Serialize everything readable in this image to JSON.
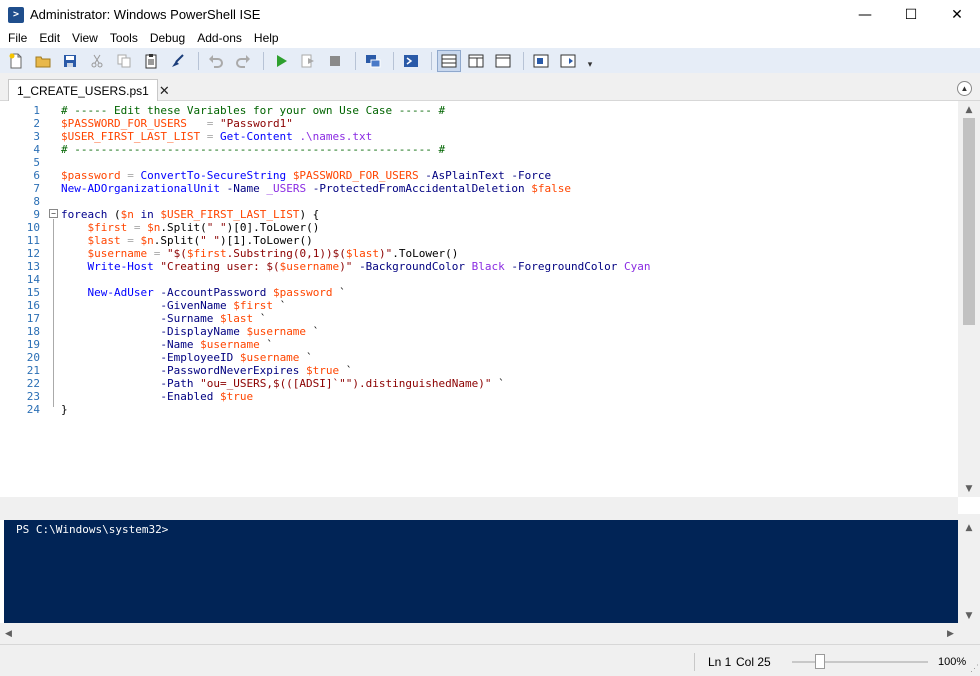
{
  "window": {
    "title": "Administrator: Windows PowerShell ISE",
    "minimize": "—",
    "maximize": "☐",
    "close": "✕"
  },
  "menu": [
    "File",
    "Edit",
    "View",
    "Tools",
    "Debug",
    "Add-ons",
    "Help"
  ],
  "toolbar": {
    "icons": [
      "new-script",
      "open",
      "save",
      "cut",
      "copy",
      "paste",
      "clear-console",
      "undo",
      "redo",
      "run-script",
      "run-selection",
      "stop",
      "new-remote-tab",
      "start-powershell",
      "show-script-top",
      "show-script-right",
      "show-script-max",
      "show-command-window",
      "show-command-addon"
    ]
  },
  "tab": {
    "label": "1_CREATE_USERS.ps1",
    "close": "✕"
  },
  "editor": {
    "lines": [
      [
        [
          "comment",
          "# ----- Edit these Variables for your own Use Case ----- #"
        ]
      ],
      [
        [
          "var",
          "$PASSWORD_FOR_USERS"
        ],
        [
          "plain",
          "   "
        ],
        [
          "op",
          "="
        ],
        [
          "plain",
          " "
        ],
        [
          "str",
          "\"Password1\""
        ]
      ],
      [
        [
          "var",
          "$USER_FIRST_LAST_LIST"
        ],
        [
          "plain",
          " "
        ],
        [
          "op",
          "="
        ],
        [
          "plain",
          " "
        ],
        [
          "cmd",
          "Get-Content"
        ],
        [
          "plain",
          " "
        ],
        [
          "arg",
          ".\\names.txt"
        ]
      ],
      [
        [
          "comment",
          "# ------------------------------------------------------ #"
        ]
      ],
      [],
      [
        [
          "var",
          "$password"
        ],
        [
          "plain",
          " "
        ],
        [
          "op",
          "="
        ],
        [
          "plain",
          " "
        ],
        [
          "cmd",
          "ConvertTo-SecureString"
        ],
        [
          "plain",
          " "
        ],
        [
          "var",
          "$PASSWORD_FOR_USERS"
        ],
        [
          "plain",
          " "
        ],
        [
          "param",
          "-AsPlainText"
        ],
        [
          "plain",
          " "
        ],
        [
          "param",
          "-Force"
        ]
      ],
      [
        [
          "cmd",
          "New-ADOrganizationalUnit"
        ],
        [
          "plain",
          " "
        ],
        [
          "param",
          "-Name"
        ],
        [
          "plain",
          " "
        ],
        [
          "arg",
          "_USERS"
        ],
        [
          "plain",
          " "
        ],
        [
          "param",
          "-ProtectedFromAccidentalDeletion"
        ],
        [
          "plain",
          " "
        ],
        [
          "var",
          "$false"
        ]
      ],
      [],
      [
        [
          "kw",
          "foreach"
        ],
        [
          "plain",
          " ("
        ],
        [
          "var",
          "$n"
        ],
        [
          "plain",
          " "
        ],
        [
          "kw",
          "in"
        ],
        [
          "plain",
          " "
        ],
        [
          "var",
          "$USER_FIRST_LAST_LIST"
        ],
        [
          "plain",
          ") {"
        ]
      ],
      [
        [
          "plain",
          "    "
        ],
        [
          "var",
          "$first"
        ],
        [
          "plain",
          " "
        ],
        [
          "op",
          "="
        ],
        [
          "plain",
          " "
        ],
        [
          "var",
          "$n"
        ],
        [
          "plain",
          ".Split("
        ],
        [
          "str",
          "\" \""
        ],
        [
          "plain",
          ")[0].ToLower()"
        ]
      ],
      [
        [
          "plain",
          "    "
        ],
        [
          "var",
          "$last"
        ],
        [
          "plain",
          " "
        ],
        [
          "op",
          "="
        ],
        [
          "plain",
          " "
        ],
        [
          "var",
          "$n"
        ],
        [
          "plain",
          ".Split("
        ],
        [
          "str",
          "\" \""
        ],
        [
          "plain",
          ")[1].ToLower()"
        ]
      ],
      [
        [
          "plain",
          "    "
        ],
        [
          "var",
          "$username"
        ],
        [
          "plain",
          " "
        ],
        [
          "op",
          "="
        ],
        [
          "plain",
          " "
        ],
        [
          "str",
          "\"$("
        ],
        [
          "var",
          "$first"
        ],
        [
          "str",
          ".Substring(0,1))$("
        ],
        [
          "var",
          "$last"
        ],
        [
          "str",
          ")\""
        ],
        [
          "plain",
          ".ToLower()"
        ]
      ],
      [
        [
          "plain",
          "    "
        ],
        [
          "cmd",
          "Write-Host"
        ],
        [
          "plain",
          " "
        ],
        [
          "str",
          "\"Creating user: $("
        ],
        [
          "var",
          "$username"
        ],
        [
          "str",
          ")\""
        ],
        [
          "plain",
          " "
        ],
        [
          "param",
          "-BackgroundColor"
        ],
        [
          "plain",
          " "
        ],
        [
          "arg",
          "Black"
        ],
        [
          "plain",
          " "
        ],
        [
          "param",
          "-ForegroundColor"
        ],
        [
          "plain",
          " "
        ],
        [
          "arg",
          "Cyan"
        ]
      ],
      [],
      [
        [
          "plain",
          "    "
        ],
        [
          "cmd",
          "New-AdUser"
        ],
        [
          "plain",
          " "
        ],
        [
          "param",
          "-AccountPassword"
        ],
        [
          "plain",
          " "
        ],
        [
          "var",
          "$password"
        ],
        [
          "plain",
          " `"
        ]
      ],
      [
        [
          "plain",
          "               "
        ],
        [
          "param",
          "-GivenName"
        ],
        [
          "plain",
          " "
        ],
        [
          "var",
          "$first"
        ],
        [
          "plain",
          " `"
        ]
      ],
      [
        [
          "plain",
          "               "
        ],
        [
          "param",
          "-Surname"
        ],
        [
          "plain",
          " "
        ],
        [
          "var",
          "$last"
        ],
        [
          "plain",
          " `"
        ]
      ],
      [
        [
          "plain",
          "               "
        ],
        [
          "param",
          "-DisplayName"
        ],
        [
          "plain",
          " "
        ],
        [
          "var",
          "$username"
        ],
        [
          "plain",
          " `"
        ]
      ],
      [
        [
          "plain",
          "               "
        ],
        [
          "param",
          "-Name"
        ],
        [
          "plain",
          " "
        ],
        [
          "var",
          "$username"
        ],
        [
          "plain",
          " `"
        ]
      ],
      [
        [
          "plain",
          "               "
        ],
        [
          "param",
          "-EmployeeID"
        ],
        [
          "plain",
          " "
        ],
        [
          "var",
          "$username"
        ],
        [
          "plain",
          " `"
        ]
      ],
      [
        [
          "plain",
          "               "
        ],
        [
          "param",
          "-PasswordNeverExpires"
        ],
        [
          "plain",
          " "
        ],
        [
          "var",
          "$true"
        ],
        [
          "plain",
          " `"
        ]
      ],
      [
        [
          "plain",
          "               "
        ],
        [
          "param",
          "-Path"
        ],
        [
          "plain",
          " "
        ],
        [
          "str",
          "\"ou=_USERS,$(([ADSI]`\"\").distinguishedName)\""
        ],
        [
          "plain",
          " `"
        ]
      ],
      [
        [
          "plain",
          "               "
        ],
        [
          "param",
          "-Enabled"
        ],
        [
          "plain",
          " "
        ],
        [
          "var",
          "$true"
        ]
      ],
      [
        [
          "plain",
          "}"
        ]
      ]
    ]
  },
  "console": {
    "prompt": "PS C:\\Windows\\system32>"
  },
  "status": {
    "line": "Ln 1",
    "col": "Col 25",
    "zoom": "100%",
    "zoom_level_percent": 100
  }
}
